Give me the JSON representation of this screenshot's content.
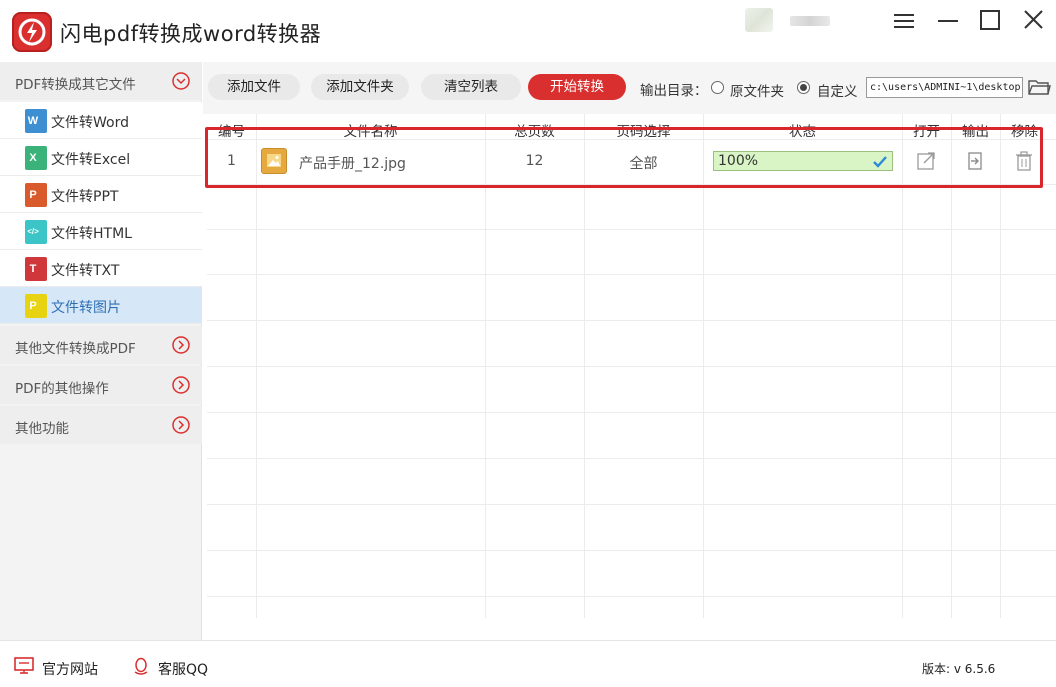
{
  "app": {
    "title": "闪电pdf转换成word转换器",
    "brand_color": "#d9302f"
  },
  "window_controls": [
    "menu-icon",
    "minimize-icon",
    "maximize-icon",
    "close-icon"
  ],
  "sidebar": {
    "groups": [
      {
        "label": "PDF转换成其它文件",
        "expanded": true,
        "items": [
          {
            "label": "文件转Word",
            "icon": "word-file-icon",
            "icon_letter": "W",
            "color": "#3d8fd1"
          },
          {
            "label": "文件转Excel",
            "icon": "excel-file-icon",
            "icon_letter": "X",
            "color": "#3ab27a"
          },
          {
            "label": "文件转PPT",
            "icon": "ppt-file-icon",
            "icon_letter": "P",
            "color": "#d95a2b"
          },
          {
            "label": "文件转HTML",
            "icon": "html-file-icon",
            "icon_letter": "</>",
            "color": "#3cc5c6"
          },
          {
            "label": "文件转TXT",
            "icon": "txt-file-icon",
            "icon_letter": "T",
            "color": "#d0373a"
          },
          {
            "label": "文件转图片",
            "icon": "image-file-icon",
            "icon_letter": "P",
            "color": "#e8d313",
            "active": true
          }
        ]
      },
      {
        "label": "其他文件转换成PDF",
        "expanded": false
      },
      {
        "label": "PDF的其他操作",
        "expanded": false
      },
      {
        "label": "其他功能",
        "expanded": false
      }
    ]
  },
  "toolbar": {
    "add_file": "添加文件",
    "add_folder": "添加文件夹",
    "clear_list": "清空列表",
    "start": "开始转换",
    "output_label": "输出目录：",
    "option_source": "原文件夹",
    "option_custom": "自定义",
    "selected_option": "自定义",
    "path": "c:\\users\\ADMINI~1\\desktop"
  },
  "table": {
    "headers": [
      "编号",
      "文件名称",
      "总页数",
      "页码选择",
      "状态",
      "打开",
      "输出",
      "移除"
    ],
    "rows": [
      {
        "index": "1",
        "filename": "产品手册_12.jpg",
        "pages": "12",
        "page_select": "全部",
        "status": "100%",
        "progress": 1.0
      }
    ]
  },
  "bottom": {
    "website": "官方网站",
    "qq": "客服QQ",
    "version": "版本: v 6.5.6"
  }
}
